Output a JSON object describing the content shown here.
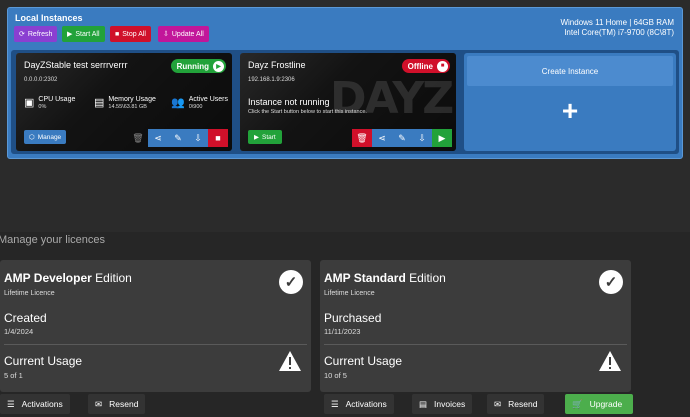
{
  "instances_panel": {
    "title": "Local Instances",
    "system_info": [
      "Windows 11 Home | 64GB RAM",
      "Intel Core(TM) i7-9700 (8C\\8T)"
    ],
    "toolbar": {
      "refresh": "Refresh",
      "start_all": "Start All",
      "stop_all": "Stop All",
      "update_all": "Update All"
    },
    "instances": [
      {
        "name": "DayZStable test serrrverrr",
        "address": "0.0.0.0:2302",
        "status": "Running",
        "stats": [
          {
            "label": "CPU Usage",
            "value": "0%"
          },
          {
            "label": "Memory Usage",
            "value": "14.55\\63.81 GB"
          },
          {
            "label": "Active Users",
            "value": "0\\900"
          }
        ],
        "manage_label": "Manage"
      },
      {
        "name": "Dayz Frostline",
        "address": "192.168.1.9:2306",
        "status": "Offline",
        "not_running_title": "Instance not running",
        "not_running_sub": "Click the Start button below to start this instance.",
        "start_label": "Start"
      }
    ],
    "create_label": "Create Instance",
    "create_plus": "+"
  },
  "licences": {
    "subtitle": "Manage your licences",
    "cards": [
      {
        "name_bold": "AMP Developer",
        "name_rest": " Edition",
        "licence_type": "Lifetime Licence",
        "date_label": "Created",
        "date_value": "1/4/2024",
        "usage_label": "Current Usage",
        "usage_value": "5 of 1"
      },
      {
        "name_bold": "AMP Standard",
        "name_rest": " Edition",
        "licence_type": "Lifetime Licence",
        "date_label": "Purchased",
        "date_value": "11/11/2023",
        "usage_label": "Current Usage",
        "usage_value": "10 of 5"
      }
    ],
    "buttons": {
      "activations_1": "Activations",
      "resend_1": "Resend",
      "activations_2": "Activations",
      "invoices": "Invoices",
      "resend_2": "Resend",
      "upgrade": "Upgrade"
    }
  },
  "colors": {
    "panel_blue": "#3a7bc0",
    "running_green": "#22a23a",
    "offline_red": "#d0102a",
    "upgrade_green": "#4cae4c"
  }
}
